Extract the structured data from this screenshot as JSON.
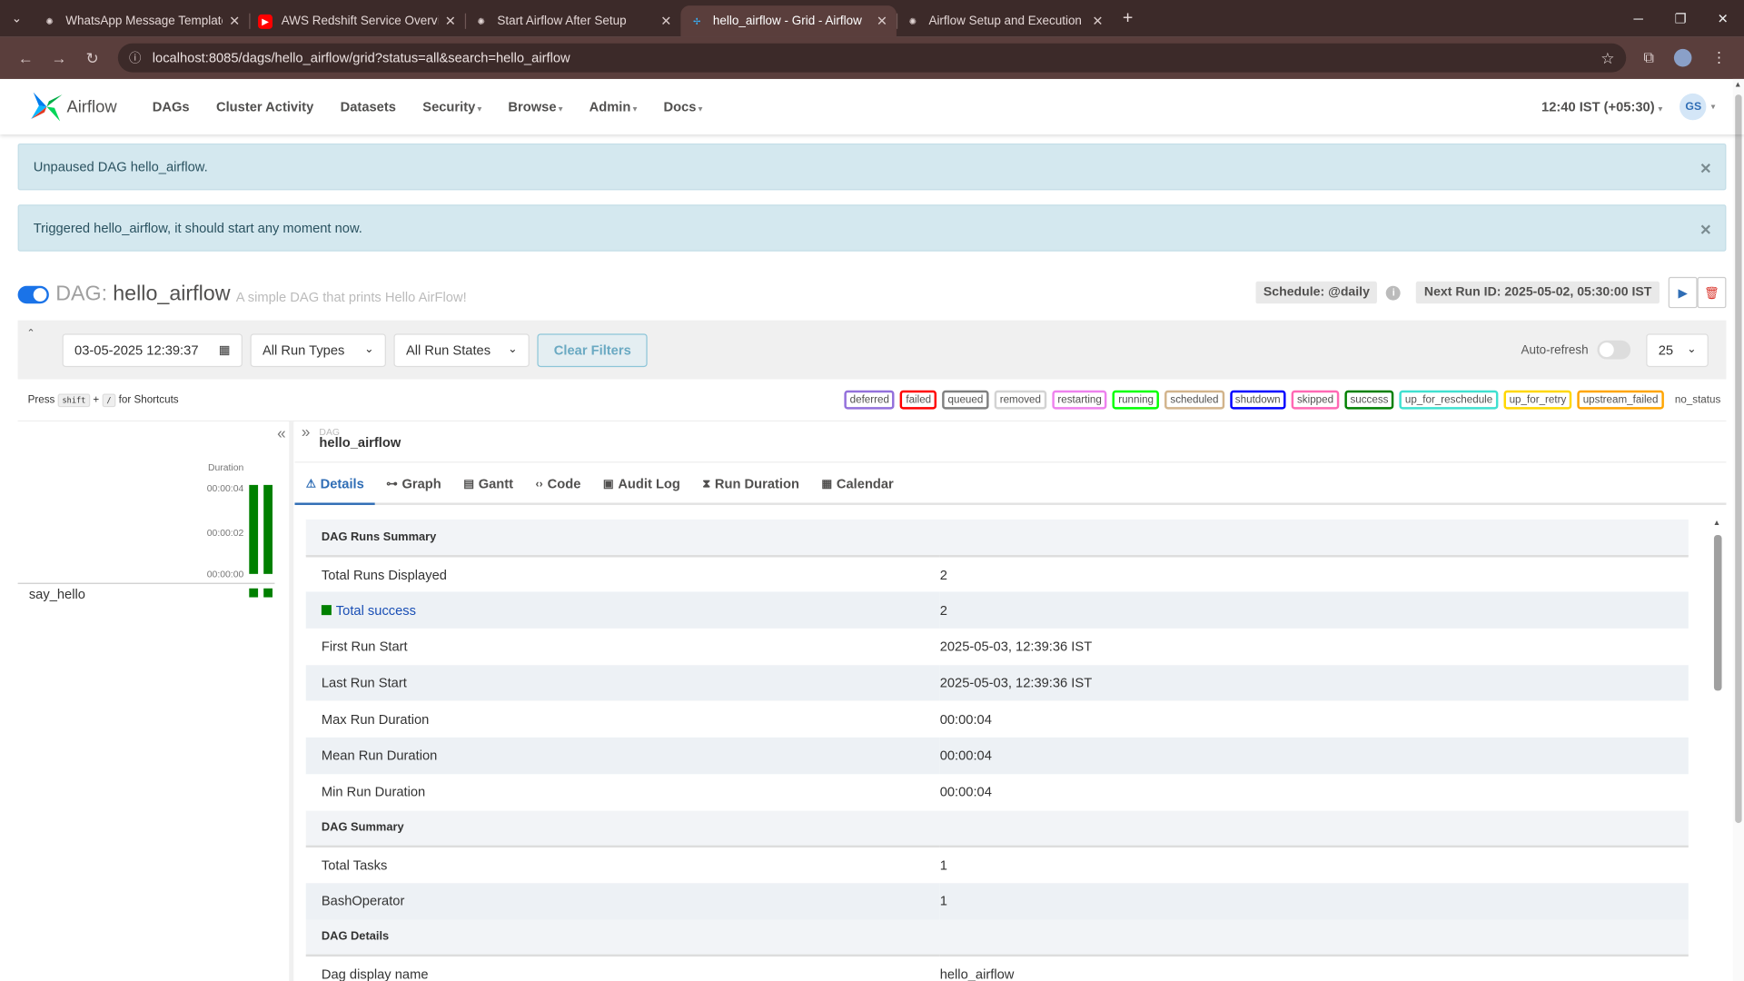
{
  "browser": {
    "tabs": [
      {
        "title": "WhatsApp Message Template",
        "icon": "openai-icon"
      },
      {
        "title": "AWS Redshift Service Overview",
        "icon": "youtube-icon"
      },
      {
        "title": "Start Airflow After Setup",
        "icon": "openai-icon"
      },
      {
        "title": "hello_airflow - Grid - Airflow",
        "icon": "airflow-icon",
        "active": true
      },
      {
        "title": "Airflow Setup and Execution",
        "icon": "openai-icon"
      }
    ],
    "url": "localhost:8085/dags/hello_airflow/grid?status=all&search=hello_airflow"
  },
  "navbar": {
    "brand": "Airflow",
    "items": [
      "DAGs",
      "Cluster Activity",
      "Datasets",
      "Security",
      "Browse",
      "Admin",
      "Docs"
    ],
    "time": "12:40 IST (+05:30)",
    "user_initials": "GS"
  },
  "alerts": [
    "Unpaused DAG hello_airflow.",
    "Triggered hello_airflow, it should start any moment now."
  ],
  "dag": {
    "label": "DAG:",
    "name": "hello_airflow",
    "description": "A simple DAG that prints Hello AirFlow!",
    "schedule": "Schedule: @daily",
    "next_run": "Next Run ID: 2025-05-02, 05:30:00 IST"
  },
  "filters": {
    "date": "03-05-2025 12:39:37",
    "run_types": "All Run Types",
    "run_states": "All Run States",
    "clear": "Clear Filters",
    "auto_refresh": "Auto-refresh",
    "page_size": "25"
  },
  "shortcut": {
    "press": "Press",
    "key1": "shift",
    "plus": "+",
    "key2": "/",
    "suffix": "for Shortcuts"
  },
  "states": [
    {
      "name": "deferred",
      "color": "#9370db"
    },
    {
      "name": "failed",
      "color": "#ff0000"
    },
    {
      "name": "queued",
      "color": "#808080"
    },
    {
      "name": "removed",
      "color": "#d3d3d3"
    },
    {
      "name": "restarting",
      "color": "#ee82ee"
    },
    {
      "name": "running",
      "color": "#00ff00"
    },
    {
      "name": "scheduled",
      "color": "#d2b48c"
    },
    {
      "name": "shutdown",
      "color": "#0000ff"
    },
    {
      "name": "skipped",
      "color": "#ff69b4"
    },
    {
      "name": "success",
      "color": "#008000"
    },
    {
      "name": "up_for_reschedule",
      "color": "#40e0d0"
    },
    {
      "name": "up_for_retry",
      "color": "#ffd700"
    },
    {
      "name": "upstream_failed",
      "color": "#ffa500"
    },
    {
      "name": "no_status",
      "color": "transparent"
    }
  ],
  "grid": {
    "duration_label": "Duration",
    "ticks": [
      "00:00:04",
      "00:00:02",
      "00:00:00"
    ],
    "run_durations_seconds": [
      4,
      4
    ],
    "task": "say_hello"
  },
  "details": {
    "crumb_label": "DAG",
    "crumb_name": "hello_airflow",
    "tabs": [
      "Details",
      "Graph",
      "Gantt",
      "Code",
      "Audit Log",
      "Run Duration",
      "Calendar"
    ],
    "rows": [
      {
        "section": "DAG Runs Summary"
      },
      {
        "key": "Total Runs Displayed",
        "value": "2"
      },
      {
        "key": "Total success",
        "value": "2",
        "success": true
      },
      {
        "key": "First Run Start",
        "value": "2025-05-03, 12:39:36 IST"
      },
      {
        "key": "Last Run Start",
        "value": "2025-05-03, 12:39:36 IST"
      },
      {
        "key": "Max Run Duration",
        "value": "00:00:04"
      },
      {
        "key": "Mean Run Duration",
        "value": "00:00:04"
      },
      {
        "key": "Min Run Duration",
        "value": "00:00:04"
      },
      {
        "section": "DAG Summary"
      },
      {
        "key": "Total Tasks",
        "value": "1"
      },
      {
        "key": "BashOperator",
        "value": "1"
      },
      {
        "section": "DAG Details"
      },
      {
        "key": "Dag display name",
        "value": "hello_airflow"
      }
    ]
  }
}
